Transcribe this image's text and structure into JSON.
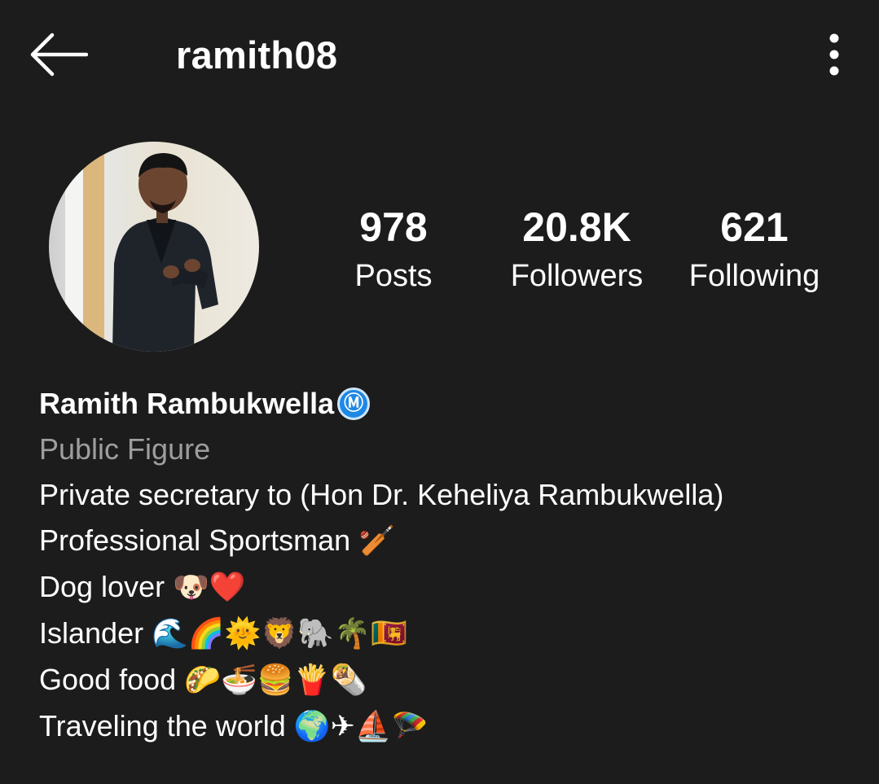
{
  "header": {
    "username": "ramith08",
    "back_icon": "arrow-left-icon",
    "menu_icon": "more-vertical-icon"
  },
  "profile": {
    "avatar_icon": "profile-photo",
    "stats": [
      {
        "value": "978",
        "label": "Posts"
      },
      {
        "value": "20.8K",
        "label": "Followers"
      },
      {
        "value": "621",
        "label": "Following"
      }
    ]
  },
  "bio": {
    "name": "Ramith Rambukwella",
    "badge": "Ⓜ",
    "category": "Public Figure",
    "lines": [
      {
        "text": "Private secretary to (Hon Dr. Keheliya Rambukwella)",
        "emoji": ""
      },
      {
        "text": "Professional Sportsman ",
        "emoji": "🏏"
      },
      {
        "text": "Dog lover ",
        "emoji": "🐶❤️"
      },
      {
        "text": "Islander ",
        "emoji": "🌊🌈🌞🦁🐘🌴🇱🇰"
      },
      {
        "text": "Good food ",
        "emoji": "🌮🍜🍔🍟🌯"
      },
      {
        "text": "Traveling the world ",
        "emoji": "🌍✈⛵🪂"
      }
    ]
  },
  "colors": {
    "background": "#1c1c1c",
    "text": "#ffffff",
    "muted": "#9e9e9e",
    "badge": "#1e88e5"
  }
}
